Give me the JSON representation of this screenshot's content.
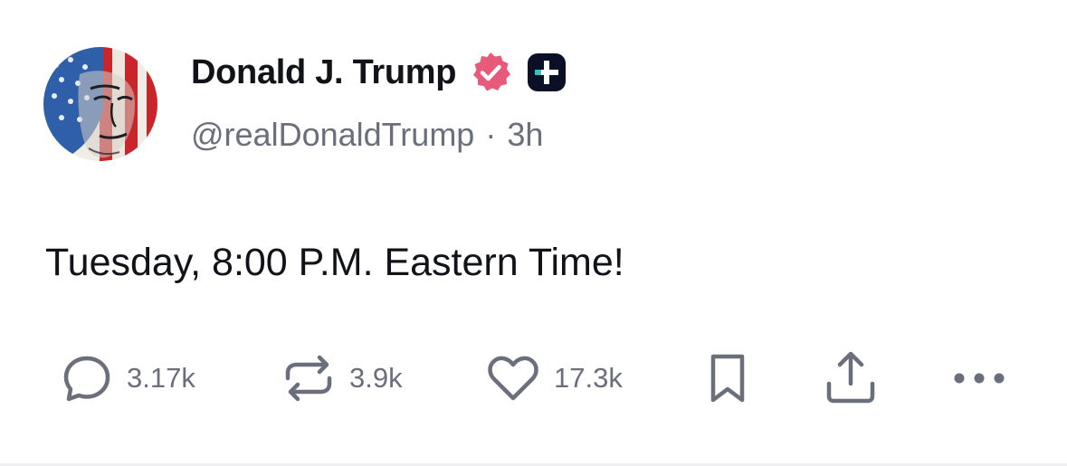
{
  "post": {
    "author": {
      "display_name": "Donald J. Trump",
      "handle": "@realDonaldTrump",
      "verified_badge_color": "#e85a79",
      "plus_badge_color": "#0b1026",
      "avatar_icon": "american-flag-portrait"
    },
    "separator": "·",
    "time_ago": "3h",
    "text": "Tuesday, 8:00 P.M. Eastern Time!",
    "actions": {
      "replies": {
        "icon": "reply-icon",
        "count": "3.17k"
      },
      "retruths": {
        "icon": "retruth-icon",
        "count": "3.9k"
      },
      "likes": {
        "icon": "heart-icon",
        "count": "17.3k"
      },
      "bookmark": {
        "icon": "bookmark-icon"
      },
      "share": {
        "icon": "share-icon"
      },
      "more": {
        "icon": "more-icon"
      }
    }
  },
  "colors": {
    "text_primary": "#111318",
    "text_secondary": "#6b6f7c",
    "icon_gray": "#6b6f7c"
  }
}
